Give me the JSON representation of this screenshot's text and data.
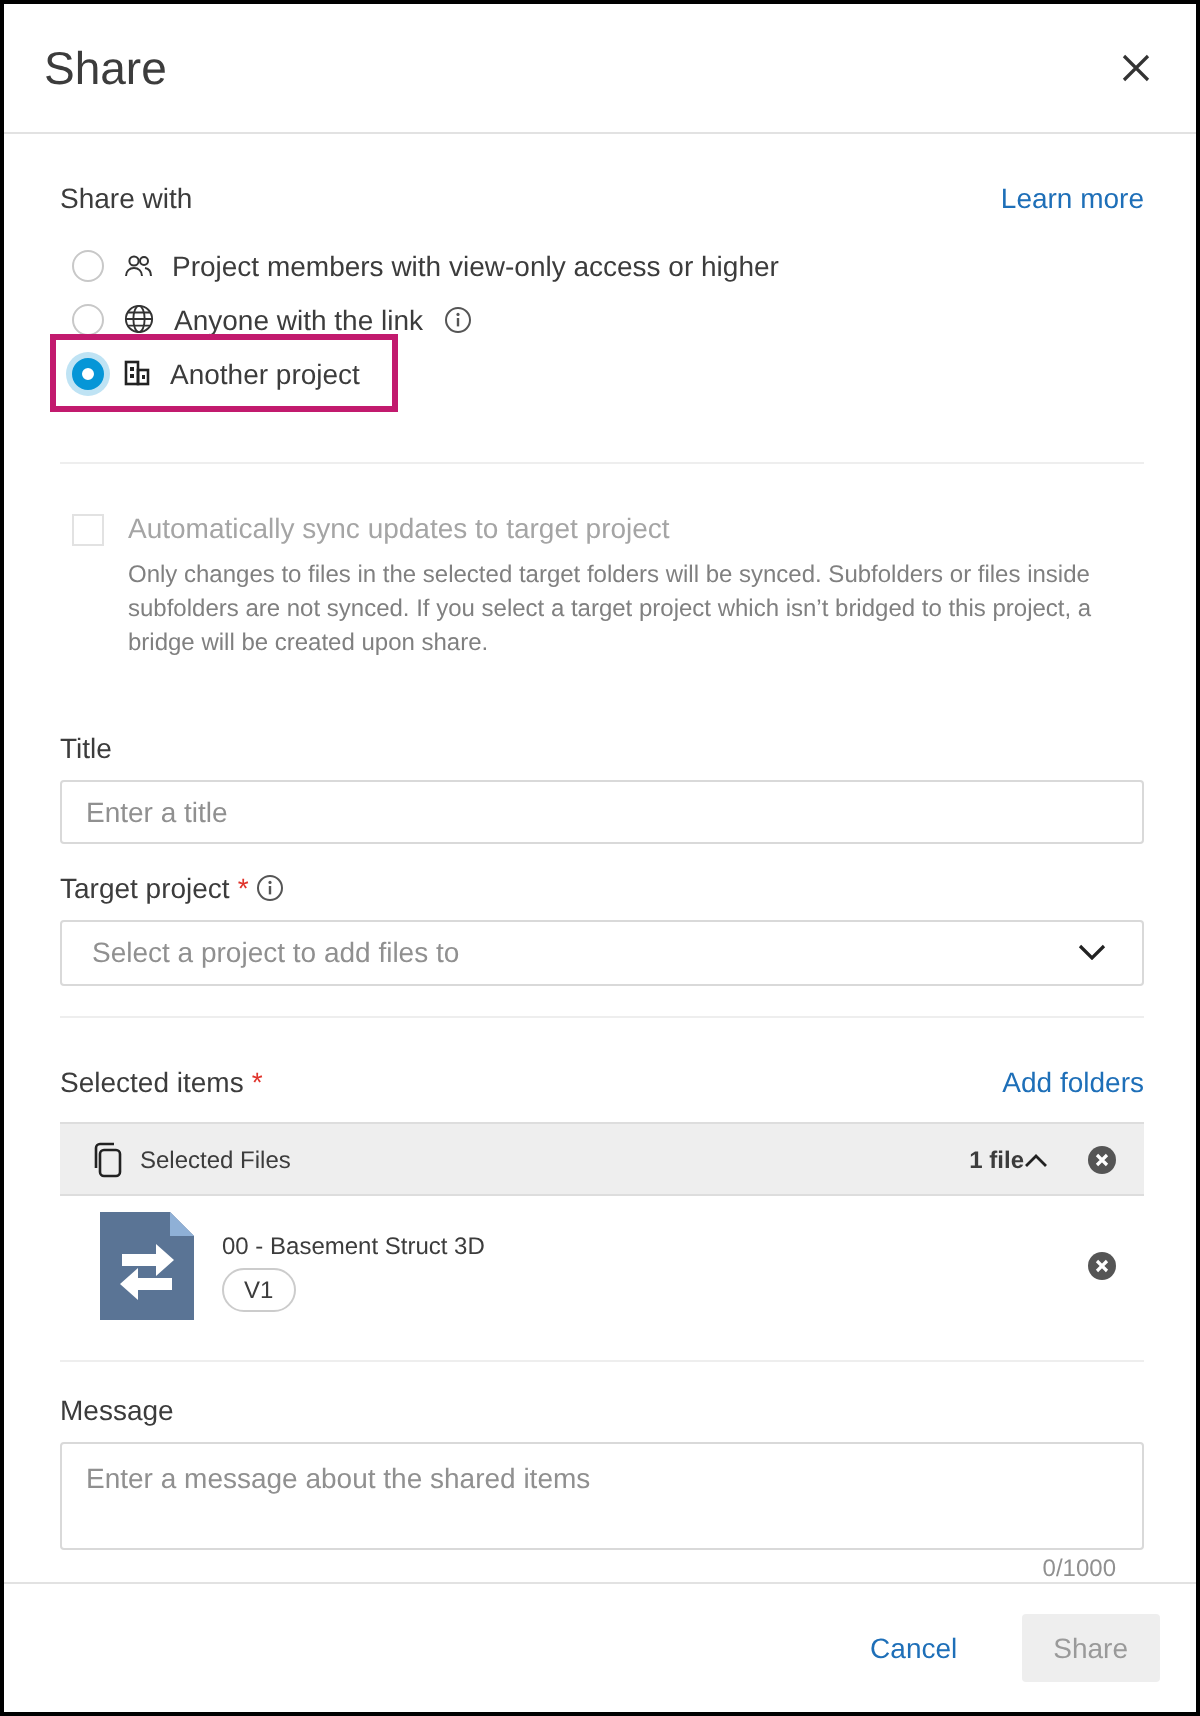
{
  "dialog": {
    "title": "Share"
  },
  "share_with": {
    "label": "Share with",
    "link": "Learn more",
    "options": [
      {
        "kind": "people",
        "label": "Project members with view-only access or higher",
        "selected": false,
        "info": false,
        "highlighted": false
      },
      {
        "kind": "globe",
        "label": "Anyone with the link",
        "selected": false,
        "info": true,
        "highlighted": false
      },
      {
        "kind": "building",
        "label": "Another project",
        "selected": true,
        "info": false,
        "highlighted": true
      }
    ]
  },
  "sync": {
    "label": "Automatically sync updates to target project",
    "checked": false,
    "disabled": true,
    "description": "Only changes to files in the selected target folders will be synced. Subfolders or files inside subfolders are not synced. If you select a target project which isn’t bridged to this project, a bridge will be created upon share."
  },
  "title_field": {
    "label": "Title",
    "placeholder": "Enter a title"
  },
  "target_project": {
    "label": "Target project",
    "required_mark": "*",
    "info": true,
    "placeholder": "Select a project to add files to"
  },
  "selected_items": {
    "label": "Selected items",
    "required_mark": "*",
    "link": "Add folders",
    "group": {
      "title": "Selected Files",
      "count": "1 file",
      "expanded": true
    },
    "files": [
      {
        "name": "00 - Basement Struct 3D",
        "version": "V1"
      }
    ]
  },
  "message": {
    "label": "Message",
    "placeholder": "Enter a message about the shared items",
    "counter": "0/1000"
  },
  "footer": {
    "buttons": [
      {
        "kind": "link",
        "label": "Cancel",
        "disabled": false
      },
      {
        "kind": "primary",
        "label": "Share",
        "disabled": true
      }
    ]
  }
}
